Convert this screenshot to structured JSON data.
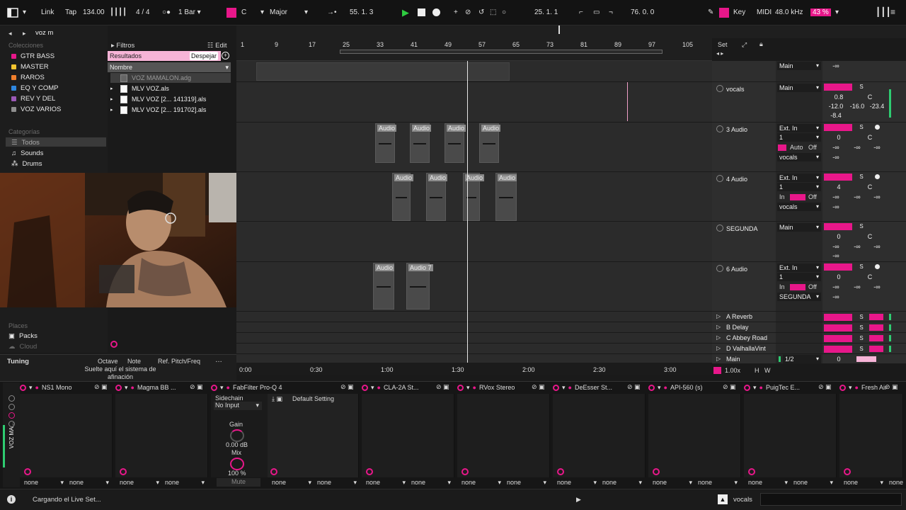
{
  "topbar": {
    "link": "Link",
    "tap": "Tap",
    "tempo": "134.00",
    "signature": "4 / 4",
    "quantize": "1 Bar",
    "key": "C",
    "scale": "Major",
    "position": "55.  1.  3",
    "loop_start": "25.  1.  1",
    "loop_length": "76.  0.  0",
    "key_btn": "Key",
    "midi_btn": "MIDI",
    "sample_rate": "48.0 kHz",
    "cpu": "43 %"
  },
  "browser": {
    "search": "voz m",
    "collections_title": "Colecciones",
    "collections": [
      {
        "label": "GTR BASS",
        "color": "#e8178a"
      },
      {
        "label": "MASTER",
        "color": "#f4c430"
      },
      {
        "label": "RAROS",
        "color": "#f07f2c"
      },
      {
        "label": "EQ Y COMP",
        "color": "#2e86de"
      },
      {
        "label": "REV Y DEL",
        "color": "#9b59b6"
      },
      {
        "label": "VOZ VARIOS",
        "color": "#8e8e8e"
      }
    ],
    "categories_title": "Categorías",
    "categories": [
      "Todos",
      "Sounds",
      "Drums"
    ],
    "filters": "Filtros",
    "edit": "Edit",
    "results": "Resultados",
    "clear": "Despejar",
    "column": "Nombre",
    "files": [
      "VOZ MAMALON.adg",
      "MLV VOZ.als",
      "MLV VOZ [2... 141319].als",
      "MLV VOZ [2... 191702].als"
    ],
    "places_title": "Places",
    "places": [
      "Packs",
      "Cloud"
    ],
    "tuning": {
      "label": "Tuning",
      "octave": "Octave",
      "note": "Note",
      "ref": "Ref. Pitch/Freq",
      "hint": "Suelte aquí el sistema de afinación"
    }
  },
  "ruler": [
    "1",
    "9",
    "17",
    "25",
    "33",
    "41",
    "49",
    "57",
    "65",
    "73",
    "81",
    "89",
    "97",
    "105"
  ],
  "ruler_set": "Set",
  "timeline": [
    "0:00",
    "0:30",
    "1:00",
    "1:30",
    "2:00",
    "2:30",
    "3:00"
  ],
  "zoom": "1.00x",
  "clips": [
    "Audio",
    "Audio",
    "Audio",
    "Audio",
    "Audio",
    "Audio",
    "Audio",
    "Audio",
    "Audio",
    "Audio 7"
  ],
  "tracks": {
    "main": "Main",
    "inf": "-∞",
    "vocals": {
      "name": "vocals",
      "out": "Main",
      "vol": "0.8",
      "pan": "C",
      "v1": "-12.0",
      "v2": "-16.0",
      "v3": "-23.4",
      "v4": "-8.4",
      "s": "S"
    },
    "t3": {
      "name": "3 Audio",
      "in": "Ext. In",
      "ch": "1",
      "vol": "0",
      "pan": "C",
      "auto": "Auto",
      "off": "Off",
      "out": "vocals"
    },
    "t4": {
      "name": "4 Audio",
      "in": "Ext. In",
      "ch": "1",
      "vol": "4",
      "pan": "C",
      "in_lbl": "In",
      "off": "Off",
      "out": "vocals"
    },
    "segunda": {
      "name": "SEGUNDA",
      "out": "Main",
      "vol": "0",
      "pan": "C"
    },
    "t6": {
      "name": "6 Audio",
      "in": "Ext. In",
      "ch": "1",
      "vol": "0",
      "pan": "C",
      "in_lbl": "In",
      "off": "Off",
      "out": "SEGUNDA"
    },
    "returns": [
      "A Reverb",
      "B Delay",
      "C Abbey Road",
      "D ValhallaVint"
    ],
    "master": {
      "name": "Main",
      "out": "1/2",
      "vol": "0"
    }
  },
  "devices": [
    "NS1 Mono",
    "Magma BB ...",
    "FabFilter Pro-Q 4",
    "CLA-2A St...",
    "RVox Stereo",
    "DeEsser St...",
    "API-560 (s)",
    "PuigTec E...",
    "Fresh Air"
  ],
  "device_extra": {
    "sidechain": "Sidechain",
    "no_input": "No Input",
    "gain": "Gain",
    "gain_val": "0.00 dB",
    "mix": "Mix",
    "mix_val": "100 %",
    "mute": "Mute",
    "default": "Default Setting",
    "none": "none"
  },
  "chain_name": "VOZ MA...",
  "status": {
    "text": "Cargando el Live Set...",
    "track": "vocals"
  }
}
